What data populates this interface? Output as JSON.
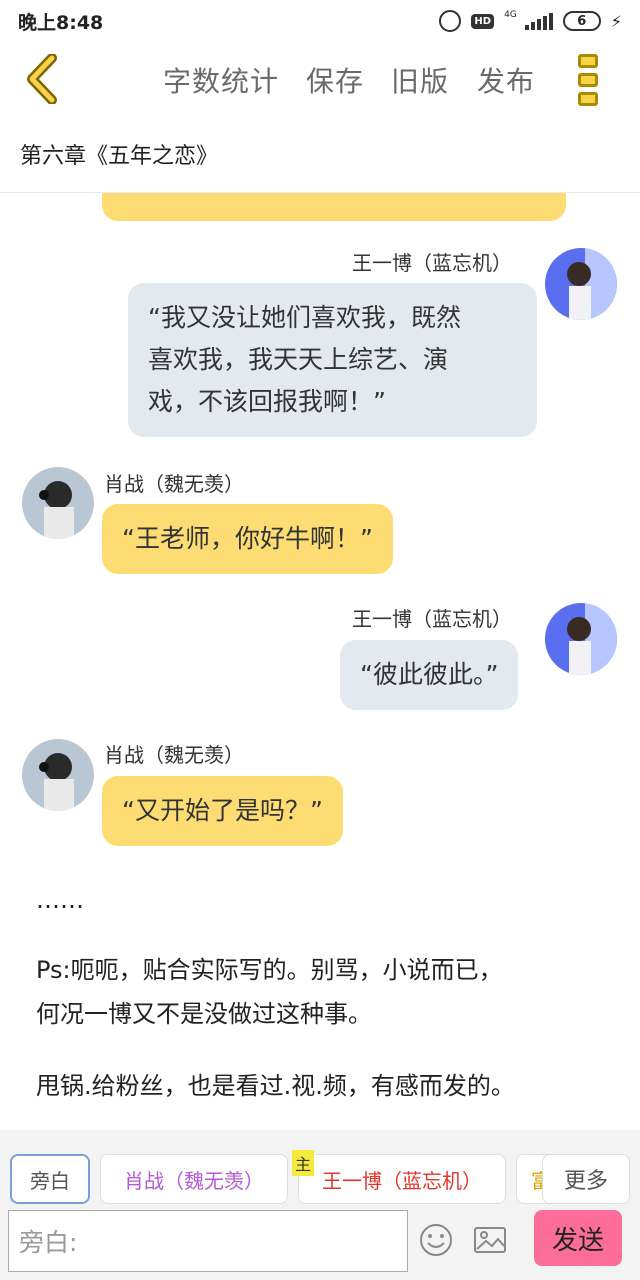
{
  "status_bar": {
    "time": "晚上8:48",
    "hd": "HD",
    "network": "4G",
    "battery": "6",
    "charging_icon": "bolt-icon"
  },
  "toolbar": {
    "word_count": "字数统计",
    "save": "保存",
    "old_version": "旧版",
    "publish": "发布"
  },
  "chapter_title": "第六章《五年之恋》",
  "messages": [
    {
      "side": "right",
      "speaker": "王一博（蓝忘机）",
      "text_lines": [
        "“我又没让她们喜欢我，既然",
        "喜欢我，我天天上综艺、演",
        "戏，不该回报我啊！”"
      ]
    },
    {
      "side": "left",
      "speaker": "肖战（魏无羡）",
      "text_lines": [
        "“王老师，你好牛啊！”"
      ]
    },
    {
      "side": "right",
      "speaker": "王一博（蓝忘机）",
      "text_lines": [
        "“彼此彼此。”"
      ]
    },
    {
      "side": "left",
      "speaker": "肖战（魏无羡）",
      "text_lines": [
        "“又开始了是吗？”"
      ]
    }
  ],
  "narration": {
    "ellipsis": "……",
    "ps_line1": "Ps:呃呃，贴合实际写的。别骂，小说而已，",
    "ps_line2": "何况一博又不是没做过这种事。",
    "ps_line3": "甩锅.给粉丝，也是看过.视.频，有感而发的。"
  },
  "character_bar": {
    "narrator": "旁白",
    "char1": "肖战（魏无羡）",
    "char2": "王一博（蓝忘机）",
    "char2_tag": "主",
    "char3_partial": "富",
    "more": "更多"
  },
  "input": {
    "placeholder": "旁白:",
    "send": "发送"
  },
  "colors": {
    "accent_yellow": "#fddd73",
    "right_bubble": "#e4e8ef",
    "send_pink": "#fd6d9a",
    "char1_color": "#b45bd6",
    "char2_color": "#e0352a"
  }
}
